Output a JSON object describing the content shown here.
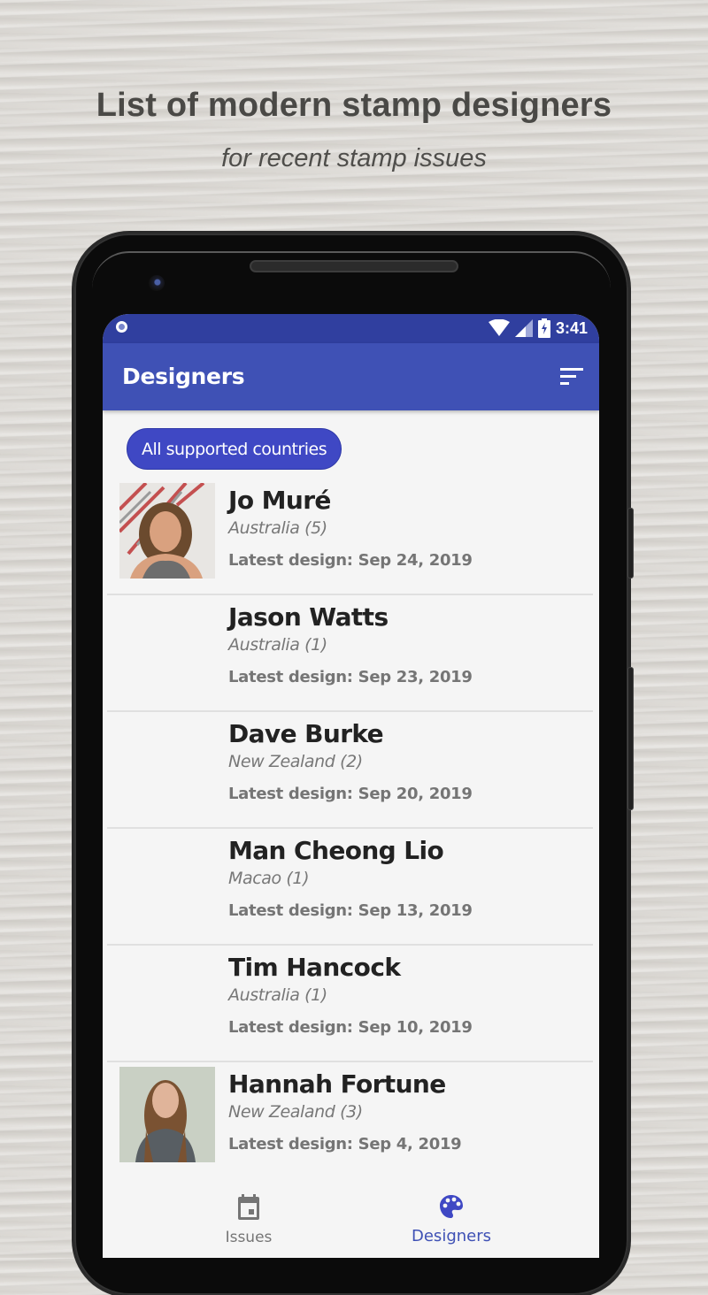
{
  "promo": {
    "title": "List of modern stamp designers",
    "subtitle": "for recent stamp issues"
  },
  "status_bar": {
    "time": "3:41",
    "icons": [
      "notification-circle-icon",
      "wifi-icon",
      "cell-signal-icon",
      "battery-charging-icon"
    ]
  },
  "app_bar": {
    "title": "Designers",
    "sort_icon": "sort-icon"
  },
  "filter_chip": {
    "label": "All supported countries"
  },
  "colors": {
    "primary": "#3f51b5",
    "primary_dark": "#303f9f",
    "chip": "#3f48c4",
    "background": "#f5f5f5"
  },
  "designers": [
    {
      "name": "Jo Muré",
      "country": "Australia (5)",
      "latest": "Latest design: Sep 24, 2019",
      "has_photo": true
    },
    {
      "name": "Jason Watts",
      "country": "Australia (1)",
      "latest": "Latest design: Sep 23, 2019",
      "has_photo": false
    },
    {
      "name": "Dave Burke",
      "country": "New Zealand (2)",
      "latest": "Latest design: Sep 20, 2019",
      "has_photo": false
    },
    {
      "name": "Man Cheong Lio",
      "country": "Macao (1)",
      "latest": "Latest design: Sep 13, 2019",
      "has_photo": false
    },
    {
      "name": "Tim Hancock",
      "country": "Australia (1)",
      "latest": "Latest design: Sep 10, 2019",
      "has_photo": false
    },
    {
      "name": "Hannah Fortune",
      "country": "New Zealand (3)",
      "latest": "Latest design: Sep 4, 2019",
      "has_photo": true
    }
  ],
  "bottom_nav": {
    "items": [
      {
        "label": "Issues",
        "icon": "calendar-icon",
        "selected": false
      },
      {
        "label": "Designers",
        "icon": "palette-icon",
        "selected": true
      }
    ]
  }
}
